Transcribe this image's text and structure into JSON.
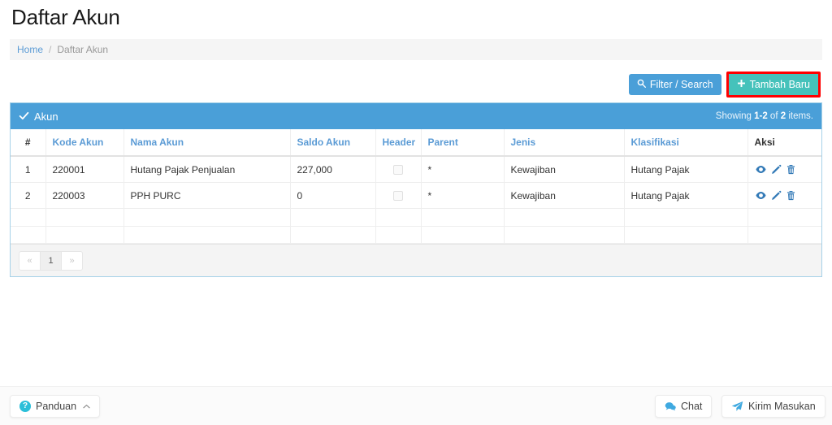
{
  "page": {
    "title": "Daftar Akun"
  },
  "breadcrumb": {
    "home": "Home",
    "separator": "/",
    "current": "Daftar Akun"
  },
  "toolbar": {
    "filter_label": "Filter / Search",
    "filter_icon": "search-icon",
    "add_label": "Tambah Baru",
    "add_icon": "plus-icon",
    "highlight_color": "#ff0000",
    "filter_color": "#4a9fd8",
    "add_color": "#45c2bb"
  },
  "panel": {
    "title": "Akun",
    "title_icon": "check-icon",
    "summary_prefix": "Showing ",
    "summary_range": "1-2",
    "summary_middle": " of ",
    "summary_total": "2",
    "summary_suffix": " items.",
    "header_color": "#4a9fd8"
  },
  "table": {
    "columns": [
      {
        "label": "#",
        "sortable": false
      },
      {
        "label": "Kode Akun",
        "sortable": true
      },
      {
        "label": "Nama Akun",
        "sortable": true
      },
      {
        "label": "Saldo Akun",
        "sortable": true
      },
      {
        "label": "Header",
        "sortable": true
      },
      {
        "label": "Parent",
        "sortable": true
      },
      {
        "label": "Jenis",
        "sortable": true
      },
      {
        "label": "Klasifikasi",
        "sortable": true
      },
      {
        "label": "Aksi",
        "sortable": false
      }
    ],
    "rows": [
      {
        "index": "1",
        "kode_akun": "220001",
        "nama_akun": "Hutang Pajak Penjualan",
        "saldo_akun": "227,000",
        "header_checked": false,
        "parent": "*",
        "jenis": "Kewajiban",
        "klasifikasi": "Hutang Pajak",
        "actions": [
          "eye-icon",
          "pencil-icon",
          "trash-icon"
        ]
      },
      {
        "index": "2",
        "kode_akun": "220003",
        "nama_akun": "PPH PURC",
        "saldo_akun": "0",
        "header_checked": false,
        "parent": "*",
        "jenis": "Kewajiban",
        "klasifikasi": "Hutang Pajak",
        "actions": [
          "eye-icon",
          "pencil-icon",
          "trash-icon"
        ]
      }
    ]
  },
  "pagination": {
    "prev_label": "«",
    "pages": [
      "1"
    ],
    "next_label": "»",
    "active_page": "1"
  },
  "footer": {
    "panduan_label": "Panduan",
    "panduan_icon": "question-circle-icon",
    "panduan_chevron": "⌃",
    "chat_label": "Chat",
    "chat_icon": "comment-icon",
    "masukan_label": "Kirim Masukan",
    "masukan_icon": "paper-plane-icon"
  }
}
